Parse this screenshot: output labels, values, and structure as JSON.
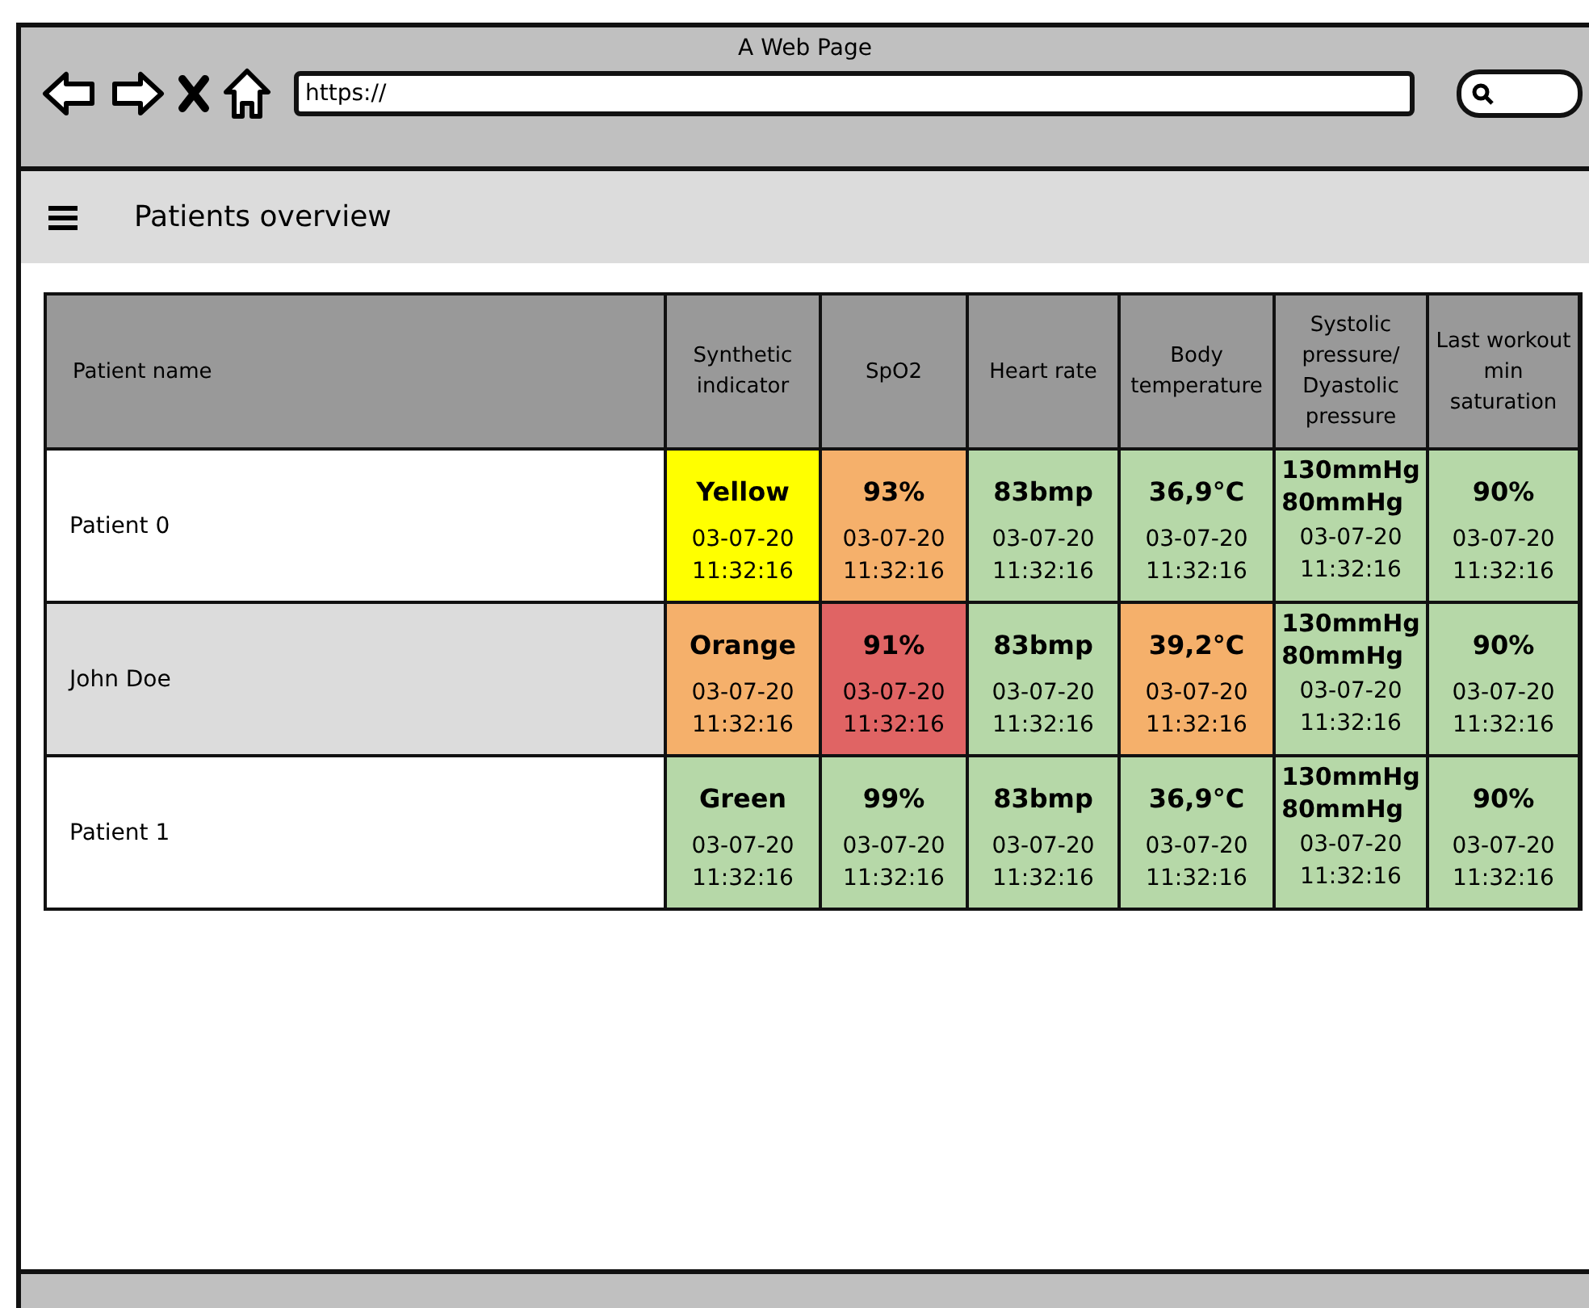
{
  "window": {
    "title": "A Web Page",
    "url": "https://"
  },
  "header": {
    "title": "Patients overview"
  },
  "table": {
    "columns": [
      "Patient name",
      "Synthetic indicator",
      "SpO2",
      "Heart rate",
      "Body temperature",
      "Systolic pressure/ Dyastolic pressure",
      "Last workout min saturation"
    ],
    "rows": [
      {
        "cells": [
          {
            "kind": "name",
            "text": "Patient 0"
          },
          {
            "kind": "status",
            "values": [
              "Yellow"
            ],
            "date": "03-07-20",
            "time": "11:32:16",
            "color": "#ffff00"
          },
          {
            "kind": "status",
            "values": [
              "93%"
            ],
            "date": "03-07-20",
            "time": "11:32:16",
            "color": "#f5b06b"
          },
          {
            "kind": "status",
            "values": [
              "83bmp"
            ],
            "date": "03-07-20",
            "time": "11:32:16",
            "color": "#b6d8a8"
          },
          {
            "kind": "status",
            "values": [
              "36,9°C"
            ],
            "date": "03-07-20",
            "time": "11:32:16",
            "color": "#b6d8a8"
          },
          {
            "kind": "status",
            "values": [
              "130mmHg",
              "80mmHg"
            ],
            "date": "03-07-20",
            "time": "11:32:16",
            "color": "#b6d8a8"
          },
          {
            "kind": "status",
            "values": [
              "90%"
            ],
            "date": "03-07-20",
            "time": "11:32:16",
            "color": "#b6d8a8"
          }
        ]
      },
      {
        "cells": [
          {
            "kind": "name",
            "text": "John Doe"
          },
          {
            "kind": "status",
            "values": [
              "Orange"
            ],
            "date": "03-07-20",
            "time": "11:32:16",
            "color": "#f5b06b"
          },
          {
            "kind": "status",
            "values": [
              "91%"
            ],
            "date": "03-07-20",
            "time": "11:32:16",
            "color": "#e06464"
          },
          {
            "kind": "status",
            "values": [
              "83bmp"
            ],
            "date": "03-07-20",
            "time": "11:32:16",
            "color": "#b6d8a8"
          },
          {
            "kind": "status",
            "values": [
              "39,2°C"
            ],
            "date": "03-07-20",
            "time": "11:32:16",
            "color": "#f5b06b"
          },
          {
            "kind": "status",
            "values": [
              "130mmHg",
              "80mmHg"
            ],
            "date": "03-07-20",
            "time": "11:32:16",
            "color": "#b6d8a8"
          },
          {
            "kind": "status",
            "values": [
              "90%"
            ],
            "date": "03-07-20",
            "time": "11:32:16",
            "color": "#b6d8a8"
          }
        ]
      },
      {
        "cells": [
          {
            "kind": "name",
            "text": "Patient 1"
          },
          {
            "kind": "status",
            "values": [
              "Green"
            ],
            "date": "03-07-20",
            "time": "11:32:16",
            "color": "#b6d8a8"
          },
          {
            "kind": "status",
            "values": [
              "99%"
            ],
            "date": "03-07-20",
            "time": "11:32:16",
            "color": "#b6d8a8"
          },
          {
            "kind": "status",
            "values": [
              "83bmp"
            ],
            "date": "03-07-20",
            "time": "11:32:16",
            "color": "#b6d8a8"
          },
          {
            "kind": "status",
            "values": [
              "36,9°C"
            ],
            "date": "03-07-20",
            "time": "11:32:16",
            "color": "#b6d8a8"
          },
          {
            "kind": "status",
            "values": [
              "130mmHg",
              "80mmHg"
            ],
            "date": "03-07-20",
            "time": "11:32:16",
            "color": "#b6d8a8"
          },
          {
            "kind": "status",
            "values": [
              "90%"
            ],
            "date": "03-07-20",
            "time": "11:32:16",
            "color": "#b6d8a8"
          }
        ]
      }
    ]
  }
}
